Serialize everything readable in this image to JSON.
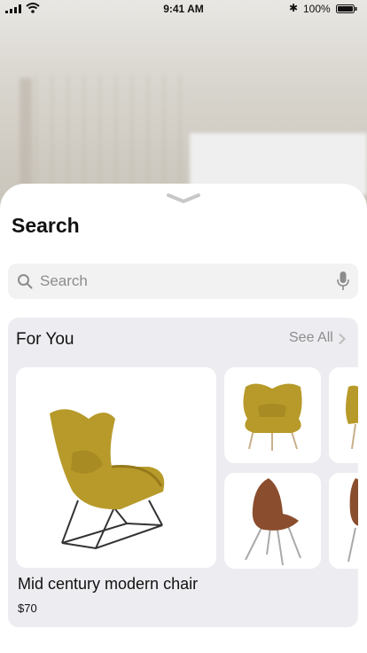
{
  "status_bar": {
    "time": "9:41 AM",
    "battery_percent": "100%",
    "bluetooth_icon": "bluetooth-icon"
  },
  "sheet": {
    "title": "Search",
    "search": {
      "placeholder": "Search",
      "icons": [
        "search-icon",
        "microphone-icon"
      ]
    }
  },
  "for_you": {
    "heading": "For You",
    "see_all": "See All",
    "featured": {
      "name": "Mid century modern chair",
      "price": "$70"
    }
  },
  "colors": {
    "sheet_bg": "#ffffff",
    "card_bg": "#ededf1",
    "accent_muted": "#8d8d8d",
    "chair_mustard": "#b79a2a",
    "chair_leather": "#8a4e2e"
  }
}
